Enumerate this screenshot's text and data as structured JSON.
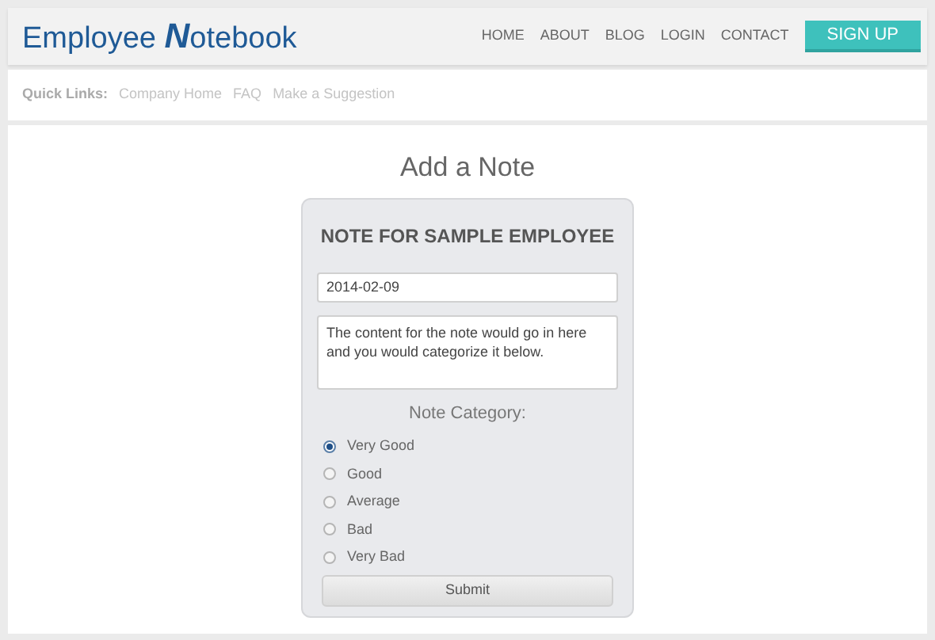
{
  "logo": "Employee **N**otebook",
  "nav": [
    "HOME",
    "ABOUT",
    "BLOG",
    "LOGIN",
    "CONTACT"
  ],
  "signup": "SIGN UP",
  "quick_links": {
    "label": "Quick Links:",
    "links": [
      "Company Home",
      "FAQ",
      "Make a Suggestion"
    ]
  },
  "page_title": "Add a Note",
  "form": {
    "heading": "NOTE FOR SAMPLE EMPLOYEE",
    "date": "2014-02-09",
    "note": "The content for the note would go in here and you would categorize it below.",
    "category_label": "Note Category:",
    "options": [
      {
        "label": "Very Good",
        "selected": true
      },
      {
        "label": "Good",
        "selected": false
      },
      {
        "label": "Average",
        "selected": false
      },
      {
        "label": "Bad",
        "selected": false
      },
      {
        "label": "Very Bad",
        "selected": false
      }
    ],
    "submit": "Submit"
  }
}
